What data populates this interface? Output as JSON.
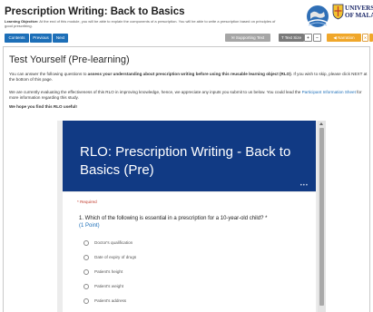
{
  "header": {
    "title": "Prescription Writing: Back to Basics",
    "objective_label": "Learning Objective:",
    "objective_text": " At the end of this module, you will be able to explain the components of a prescription. You will be able to write a prescription based on principles of good prescribing."
  },
  "logo": {
    "university_line1": "UNIVERSITY",
    "university_line2": "OF MALAYA"
  },
  "nav": {
    "contents": "Contents",
    "previous": "Previous",
    "next": "Next"
  },
  "toolbar": {
    "supporting_text": "✉ Supporting Text",
    "text_size": "T Text Size",
    "plus": "+",
    "minus": "−",
    "narration": "◀ Narration",
    "close": "✕"
  },
  "content": {
    "heading": "Test Yourself (Pre-learning)",
    "p1_a": "You can answer the following questions to ",
    "p1_bold": "assess your understanding about prescription writing before using this reusable learning object (RLO)",
    "p1_b": ". If you wish to skip, please click NEXT at the bottom of this page.",
    "p2_a": "We are currently evaluating the effectiveness of this RLO in improving knowledge, hence, we appreciate any inputs you submit to us below. You could lead the ",
    "p2_link": "Participant Information Sheet",
    "p2_b": " for more information regarding this study.",
    "p3": "We hope you find this RLO useful!"
  },
  "form": {
    "title": "RLO: Prescription Writing - Back to Basics (Pre)",
    "dots": "•••",
    "required": "* Required",
    "question": "1. Which of the following is essential in a prescription for a 10-year-old child? *",
    "points": "(1 Point)",
    "options": [
      "Doctor's qualification",
      "Date of expiry of drugs",
      "Patient's height",
      "Patient's weight",
      "Patient's address"
    ]
  },
  "colors": {
    "nav_button": "#1d6fb8",
    "form_banner": "#113a84",
    "narration": "#f0a72a"
  }
}
